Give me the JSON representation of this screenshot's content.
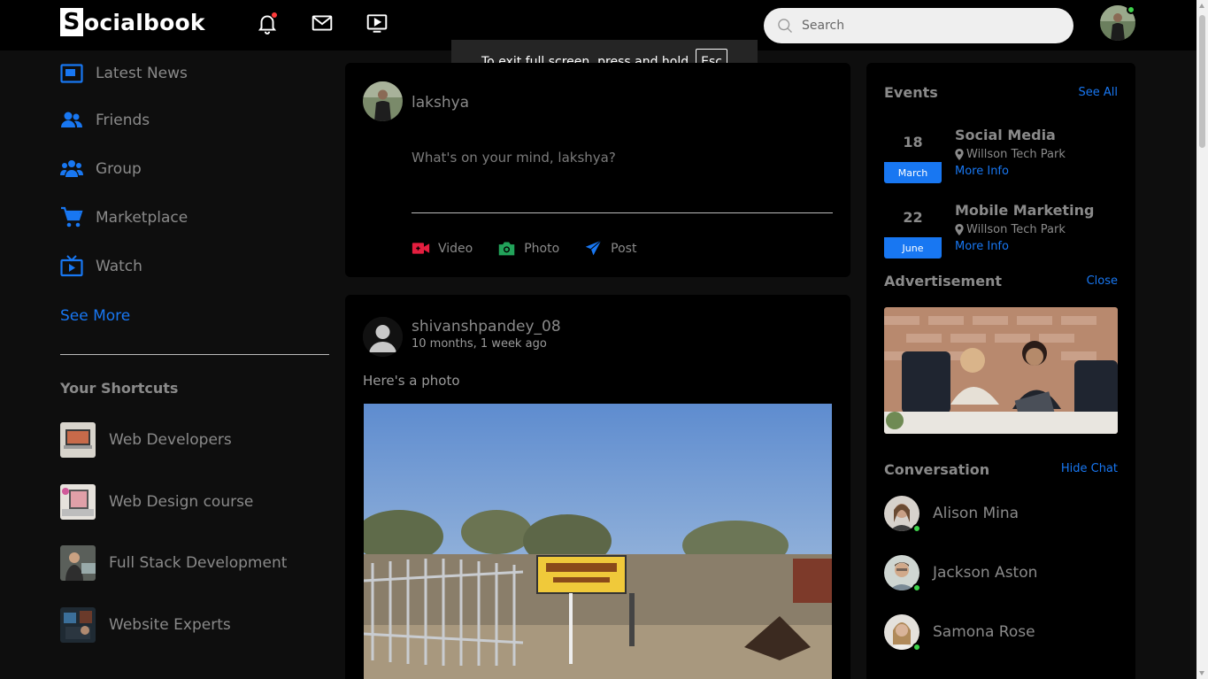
{
  "navbar": {
    "logo_initial": "S",
    "logo_rest": "ocialbook",
    "search_placeholder": "Search"
  },
  "toast": {
    "text": "To exit full screen, press and hold",
    "key": "Esc"
  },
  "sidebar": {
    "items": [
      {
        "label": "Latest News",
        "icon": "news-icon"
      },
      {
        "label": "Friends",
        "icon": "friends-icon"
      },
      {
        "label": "Group",
        "icon": "group-icon"
      },
      {
        "label": "Marketplace",
        "icon": "cart-icon"
      },
      {
        "label": "Watch",
        "icon": "tv-icon"
      }
    ],
    "see_more": "See More",
    "shortcuts_title": "Your Shortcuts",
    "shortcuts": [
      {
        "label": "Web Developers"
      },
      {
        "label": "Web Design course"
      },
      {
        "label": "Full Stack Development"
      },
      {
        "label": "Website Experts"
      }
    ]
  },
  "composer": {
    "username": "lakshya",
    "placeholder": "What's on your mind, lakshya?",
    "actions": [
      {
        "label": "Video",
        "icon": "video-icon",
        "color": "#e41e3f"
      },
      {
        "label": "Photo",
        "icon": "camera-icon",
        "color": "#22a35a"
      },
      {
        "label": "Post",
        "icon": "send-icon",
        "color": "#1877f2"
      }
    ]
  },
  "post": {
    "username": "shivanshpandey_08",
    "time": "10 months, 1 week ago",
    "text": "Here's a photo"
  },
  "events": {
    "title": "Events",
    "see_all": "See All",
    "items": [
      {
        "day": "18",
        "month": "March",
        "title": "Social Media",
        "location": "Willson Tech Park",
        "more": "More Info"
      },
      {
        "day": "22",
        "month": "June",
        "title": "Mobile Marketing",
        "location": "Willson Tech Park",
        "more": "More Info"
      }
    ]
  },
  "advertisement": {
    "title": "Advertisement",
    "close": "Close"
  },
  "conversation": {
    "title": "Conversation",
    "hide": "Hide Chat",
    "contacts": [
      {
        "name": "Alison Mina"
      },
      {
        "name": "Jackson Aston"
      },
      {
        "name": "Samona Rose"
      }
    ]
  },
  "colors": {
    "accent": "#1877f2",
    "online": "#3ed24b",
    "notification": "#ff3b3b"
  }
}
